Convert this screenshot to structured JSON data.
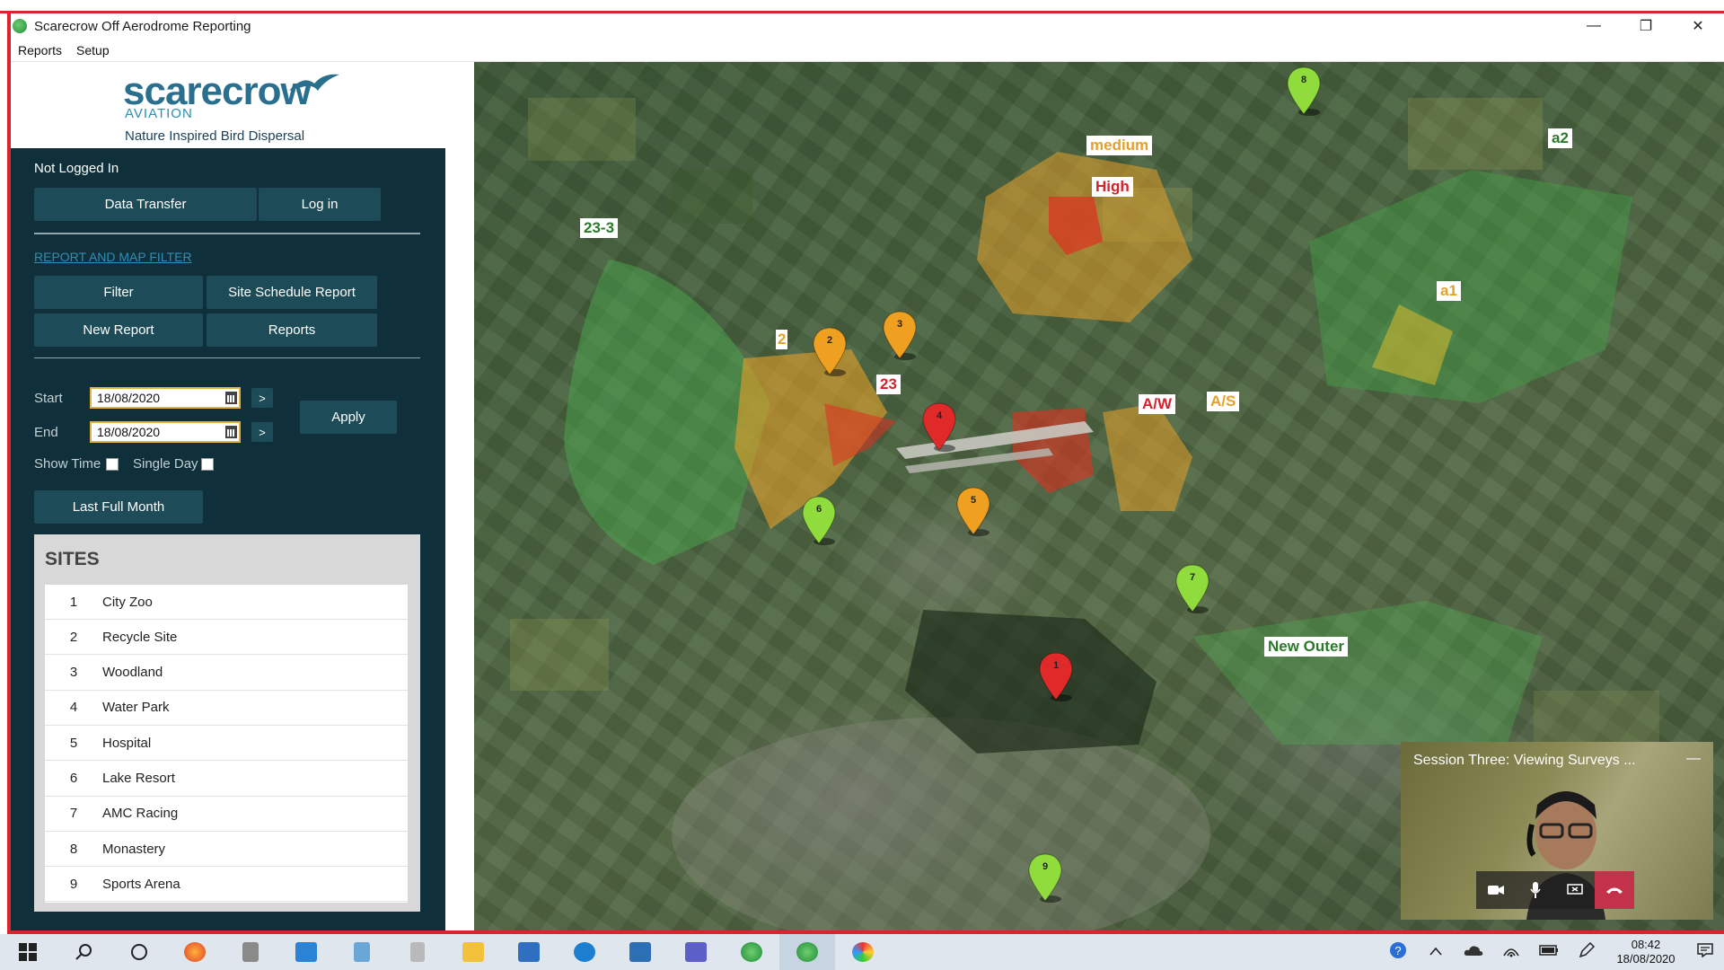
{
  "window": {
    "title": "Scarecrow Off Aerodrome Reporting",
    "minimize": "—",
    "restore": "❐",
    "close": "✕"
  },
  "menu": [
    "Reports",
    "Setup"
  ],
  "logo": {
    "brand": "scarecrow",
    "sub": "AVIATION",
    "tagline": "Nature Inspired Bird Dispersal"
  },
  "status": "Not  Logged In",
  "buttons": {
    "data_transfer": "Data Transfer",
    "log_in": "Log in",
    "filter": "Filter",
    "site_schedule": "Site Schedule Report",
    "new_report": "New Report",
    "reports": "Reports",
    "apply": "Apply",
    "last_full_month": "Last Full Month"
  },
  "filter_link": "REPORT AND MAP FILTER",
  "dates": {
    "start_label": "Start",
    "start_value": "18/08/2020",
    "end_label": "End",
    "end_value": "18/08/2020",
    "next": ">"
  },
  "options": {
    "show_time": "Show Time",
    "single_day": "Single Day"
  },
  "sites": {
    "title": "SITES",
    "items": [
      {
        "num": "1",
        "name": "City Zoo"
      },
      {
        "num": "2",
        "name": "Recycle Site"
      },
      {
        "num": "3",
        "name": "Woodland"
      },
      {
        "num": "4",
        "name": "Water Park"
      },
      {
        "num": "5",
        "name": "Hospital"
      },
      {
        "num": "6",
        "name": "Lake Resort"
      },
      {
        "num": "7",
        "name": "AMC Racing"
      },
      {
        "num": "8",
        "name": "Monastery"
      },
      {
        "num": "9",
        "name": "Sports Arena"
      }
    ]
  },
  "map": {
    "labels": {
      "medium": "medium",
      "high": "High",
      "l23_3": "23-3",
      "a2": "a2",
      "a1": "a1",
      "l23": "23",
      "aw": "A/W",
      "as": "A/S",
      "new_outer": "New Outer",
      "l2": "2"
    },
    "pins": [
      {
        "num": "1",
        "color": "#e02a2a"
      },
      {
        "num": "2",
        "color": "#f0a020"
      },
      {
        "num": "3",
        "color": "#f0a020"
      },
      {
        "num": "4",
        "color": "#e02a2a"
      },
      {
        "num": "5",
        "color": "#f0a020"
      },
      {
        "num": "6",
        "color": "#8fdc3c"
      },
      {
        "num": "7",
        "color": "#8fdc3c"
      },
      {
        "num": "8",
        "color": "#8fdc3c"
      },
      {
        "num": "9",
        "color": "#8fdc3c"
      }
    ]
  },
  "video": {
    "title": "Session Three: Viewing Surveys ...",
    "minimize": "—"
  },
  "clock": {
    "time": "08:42",
    "date": "18/08/2020"
  },
  "colors": {
    "panel": "#0f2f3a",
    "button": "#1d4b57",
    "accent_red": "#d9262e",
    "link": "#2f8fb4"
  }
}
